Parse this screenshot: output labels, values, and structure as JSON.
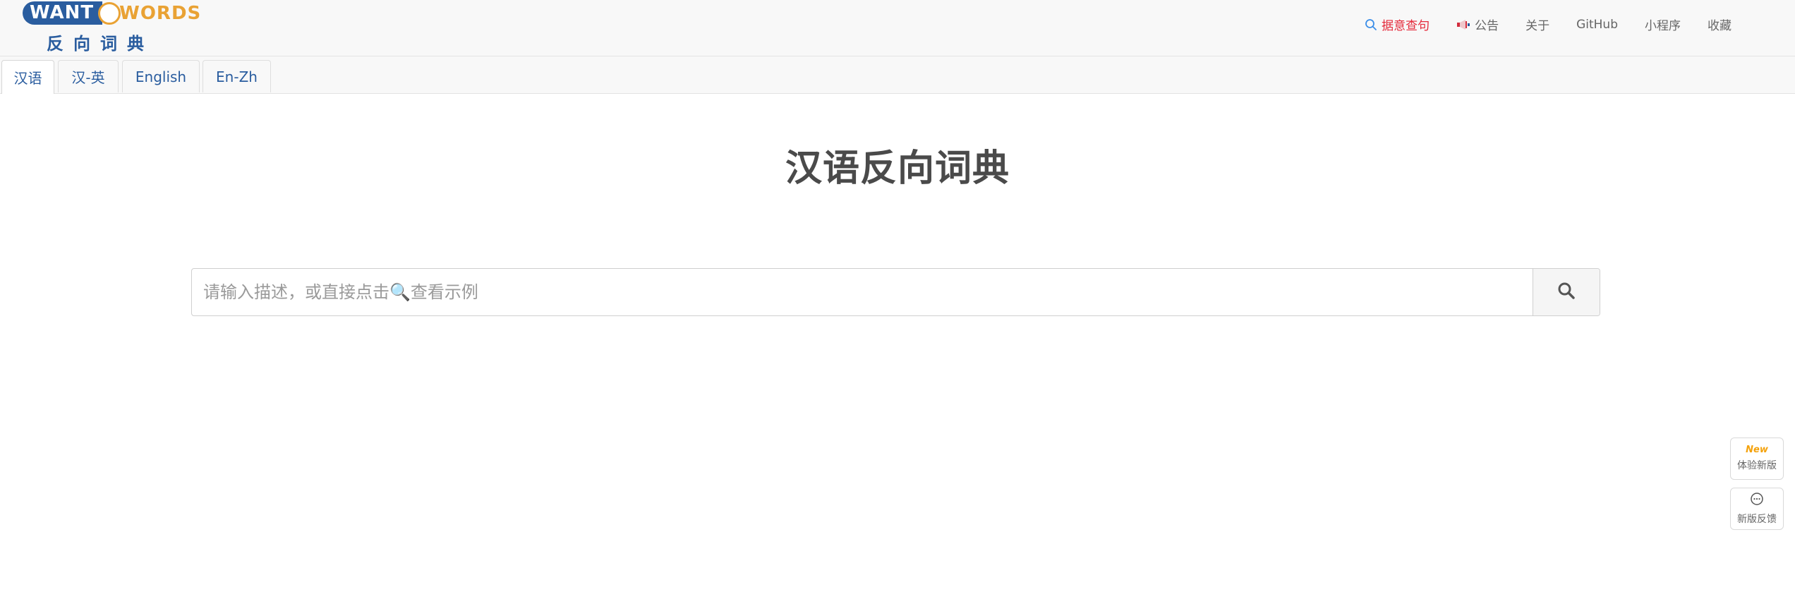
{
  "logo": {
    "want": "WANT",
    "words": "WORDS",
    "subtitle": "反向词典"
  },
  "nav": [
    {
      "label": "据意查句",
      "icon": "search-icon",
      "active": true
    },
    {
      "label": "公告",
      "icon": "megaphone-icon"
    },
    {
      "label": "关于"
    },
    {
      "label": "GitHub"
    },
    {
      "label": "小程序"
    },
    {
      "label": "收藏"
    }
  ],
  "tabs": [
    "汉语",
    "汉-英",
    "English",
    "En-Zh"
  ],
  "main": {
    "title": "汉语反向词典",
    "search_placeholder": "请输入描述，或直接点击🔍查看示例"
  },
  "floating": {
    "new_badge": "New",
    "try_new": "体验新版",
    "feedback": "新版反馈"
  },
  "colors": {
    "brand_blue": "#2a5d9f",
    "brand_orange": "#e9a234",
    "active_red": "#e42a3b"
  }
}
